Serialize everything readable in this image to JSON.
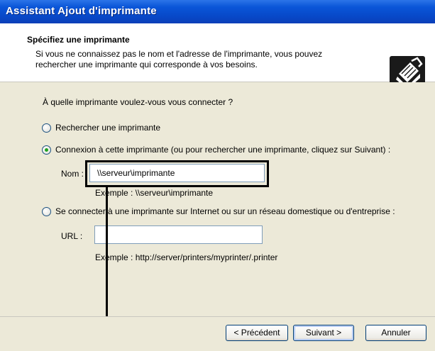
{
  "window": {
    "title": "Assistant Ajout d'imprimante"
  },
  "header": {
    "heading": "Spécifiez une imprimante",
    "description_line1": "Si vous ne connaissez pas le nom et l'adresse de l'imprimante, vous pouvez",
    "description_line2": "rechercher une imprimante qui corresponde à vos besoins.",
    "icon": "printer-wizard-icon"
  },
  "body": {
    "question": "À quelle imprimante voulez-vous vous connecter ?",
    "options": [
      {
        "label": "Rechercher une imprimante",
        "checked": false
      },
      {
        "label": "Connexion à cette imprimante (ou pour rechercher une imprimante, cliquez sur Suivant) :",
        "checked": true
      },
      {
        "label": "Se connecter à une imprimante sur Internet ou sur un réseau domestique ou d'entreprise :",
        "checked": false
      }
    ],
    "name_field": {
      "label": "Nom :",
      "value": "\\\\serveur\\imprimante",
      "example": "Exemple : \\\\serveur\\imprimante"
    },
    "url_field": {
      "label": "URL :",
      "value": "",
      "example": "Exemple : http://server/printers/myprinter/.printer"
    }
  },
  "footer": {
    "back_label": "< Précédent",
    "next_label": "Suivant >",
    "cancel_label": "Annuler"
  }
}
